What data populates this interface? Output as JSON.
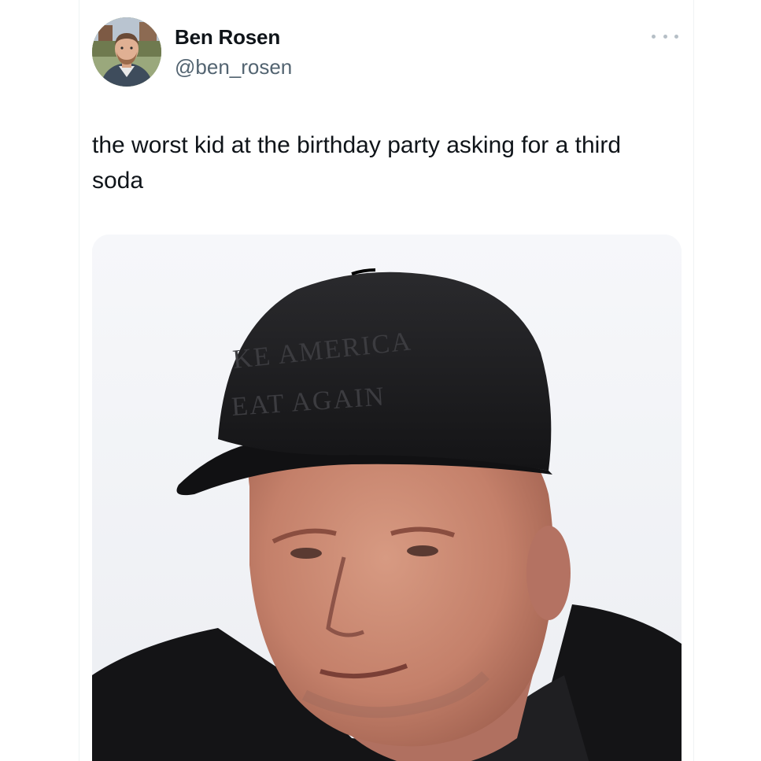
{
  "tweet": {
    "author": {
      "name": "Ben Rosen",
      "handle": "@ben_rosen"
    },
    "text": "the worst kid at the birthday party asking for a third soda",
    "media": {
      "hat_text": {
        "line1": "KE AMERICA",
        "line2": "EAT AGAIN"
      }
    }
  },
  "icons": {
    "more": "more-horizontal-icon"
  },
  "colors": {
    "text_primary": "#0f1419",
    "text_secondary": "#536471",
    "icon_gray": "#b6bfc6",
    "background": "#ffffff"
  }
}
